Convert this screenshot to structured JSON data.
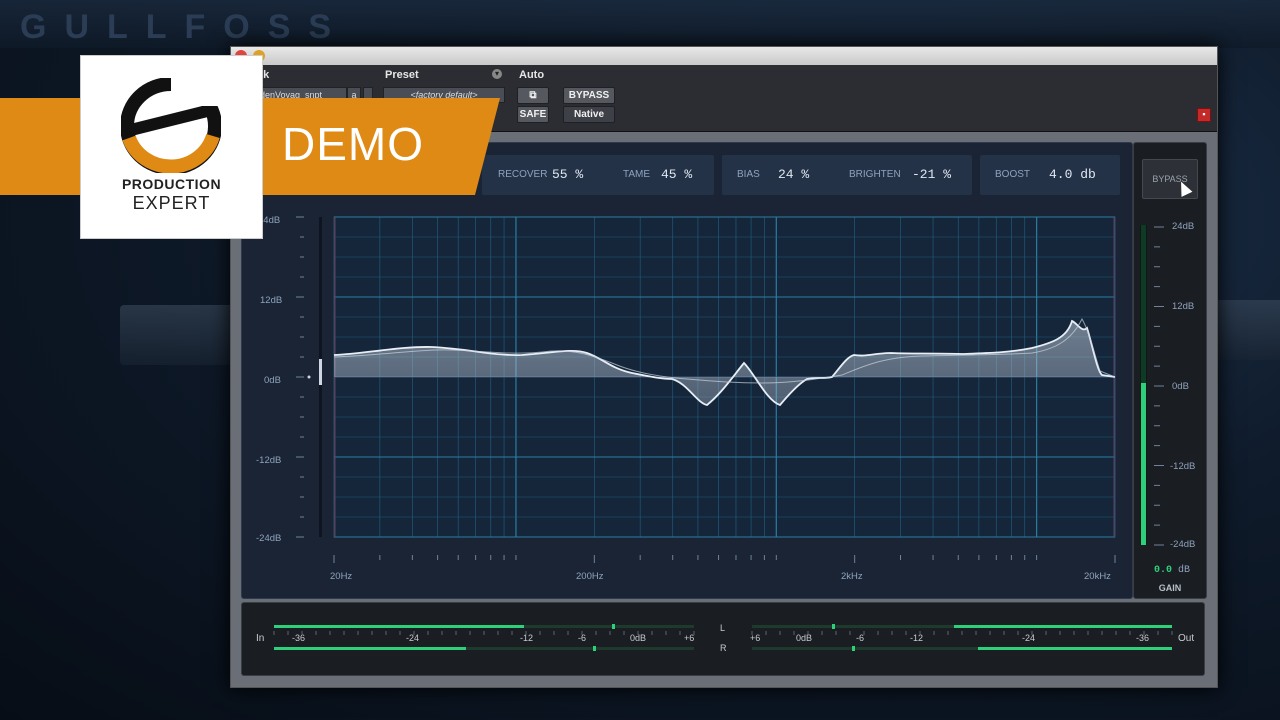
{
  "background": {
    "brand_letters": "GULLFOSS"
  },
  "header": {
    "track_label": "ck",
    "track_value": "denVoyag_snpt",
    "track_letter": "a",
    "preset_label": "Preset",
    "preset_value": "<factory default>",
    "auto_label": "Auto",
    "safe_label": "SAFE",
    "bypass_label": "BYPASS",
    "native_label": "Native"
  },
  "params": {
    "recover": {
      "label": "RECOVER",
      "value": "55 %"
    },
    "tame": {
      "label": "TAME",
      "value": "45 %"
    },
    "bias": {
      "label": "BIAS",
      "value": "24 %"
    },
    "brighten": {
      "label": "BRIGHTEN",
      "value": "-21 %"
    },
    "boost": {
      "label": "BOOST",
      "value": "4.0 db"
    }
  },
  "graph": {
    "y_labels": [
      "24dB",
      "12dB",
      "0dB",
      "-12dB",
      "-24dB"
    ],
    "x_labels": [
      "20Hz",
      "200Hz",
      "2kHz",
      "20kHz"
    ]
  },
  "gain": {
    "bypass_label": "BYPASS",
    "y_labels": [
      "24dB",
      "12dB",
      "0dB",
      "-12dB",
      "-24dB"
    ],
    "value": "0.0",
    "unit": "dB",
    "label": "GAIN"
  },
  "meters": {
    "in_label": "In",
    "out_label": "Out",
    "l_label": "L",
    "r_label": "R",
    "in_scale": [
      "-36",
      "-24",
      "-12",
      "-6",
      "0dB",
      "+6"
    ],
    "out_scale": [
      "+6",
      "0dB",
      "-6",
      "-12",
      "-24",
      "-36"
    ]
  },
  "overlay": {
    "demo": "DEMO",
    "brand_line1": "PRODUCTION",
    "brand_line2": "EXPERT"
  },
  "colors": {
    "accent_orange": "#df8a15",
    "meter_green": "#2fd07a",
    "grid_blue": "#1e6a8a"
  }
}
